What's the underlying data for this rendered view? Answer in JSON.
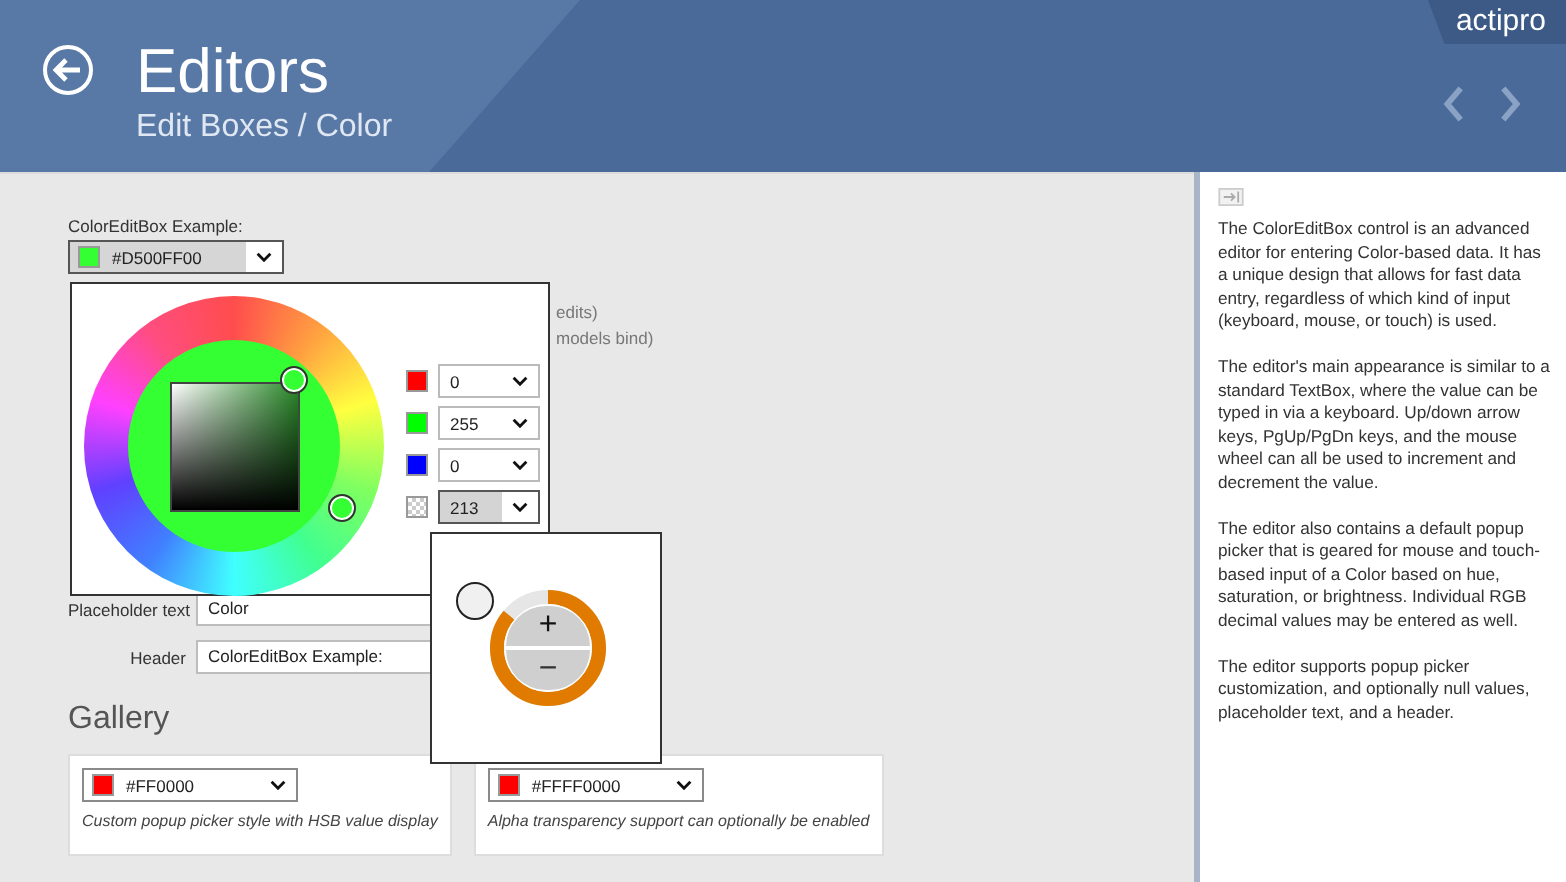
{
  "header": {
    "title": "Editors",
    "subtitle": "Edit Boxes / Color",
    "brand": "actipro"
  },
  "example": {
    "label": "ColorEditBox Example:",
    "value": "#D500FF00",
    "color": "#33ff33"
  },
  "picker": {
    "channels": [
      {
        "kind": "red",
        "value": "0",
        "color": "#ff0000",
        "selected": false
      },
      {
        "kind": "green",
        "value": "255",
        "color": "#00ff00",
        "selected": false
      },
      {
        "kind": "blue",
        "value": "0",
        "color": "#0000ff",
        "selected": false
      },
      {
        "kind": "alpha",
        "value": "213",
        "selected": true
      }
    ]
  },
  "options_behind": [
    "edits)",
    "models bind)"
  ],
  "settings": [
    {
      "label": "Placeholder text",
      "value": "Color"
    },
    {
      "label": "Header",
      "value": "ColorEditBox Example:"
    }
  ],
  "stepper": {
    "increment": "+",
    "decrement": "−",
    "level": 0.86
  },
  "gallery": {
    "title": "Gallery",
    "items": [
      {
        "value": "#FF0000",
        "color": "#ff0000",
        "caption": "Custom popup picker style with HSB value display"
      },
      {
        "value": "#FFFF0000",
        "color": "#ff0000",
        "caption": "Alpha transparency support can optionally be enabled"
      }
    ]
  },
  "description": [
    "The ColorEditBox control is an advanced editor for entering Color-based data. It has a unique design that allows for fast data entry, regardless of which kind of input (keyboard, mouse, or touch) is used.",
    "The editor's main appearance is similar to a standard TextBox, where the value can be typed in via a keyboard. Up/down arrow keys, PgUp/PgDn keys, and the mouse wheel can all be used to increment and decrement the value.",
    "The editor also contains a default popup picker that is geared for mouse and touch-based input of a Color based on hue, saturation, or brightness. Individual RGB decimal values may be entered as well.",
    "The editor supports popup picker customization, and optionally null values, placeholder text, and a header."
  ]
}
